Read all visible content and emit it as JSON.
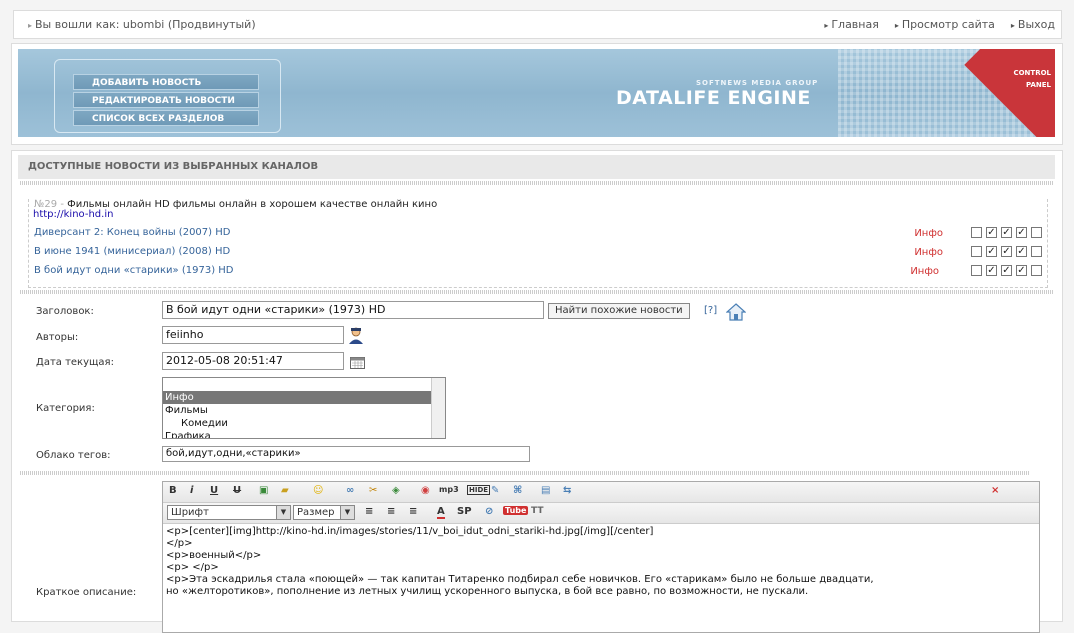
{
  "topbar": {
    "logged_in": "Вы вошли как: ubombi (Продвинутый)",
    "links": [
      "Главная",
      "Просмотр сайта",
      "Выход"
    ]
  },
  "banner": {
    "menu": [
      "ДОБАВИТЬ НОВОСТЬ",
      "РЕДАКТИРОВАТЬ НОВОСТИ",
      "СПИСОК ВСЕХ РАЗДЕЛОВ"
    ],
    "subtitle": "SOFTNEWS MEDIA GROUP",
    "logo": "DATALIFE ENGINE",
    "corner_line1": "CONTROL",
    "corner_line2": "PANEL"
  },
  "section_title": "ДОСТУПНЫЕ НОВОСТИ ИЗ ВЫБРАННЫХ КАНАЛОВ",
  "feed": {
    "number": "№29",
    "sep": "-",
    "title": "Фильмы онлайн HD фильмы онлайн в хорошем качестве онлайн кино",
    "url": "http://kino-hd.in",
    "items": [
      {
        "title": "Диверсант 2: Конец войны (2007) HD",
        "info": "Инфо",
        "checks": [
          false,
          true,
          true,
          true,
          false
        ]
      },
      {
        "title": "В июне 1941 (минисериал) (2008) HD",
        "info": "Инфо",
        "checks": [
          false,
          true,
          true,
          true,
          false
        ]
      },
      {
        "title": "В бой идут одни «старики» (1973) HD",
        "info": "Инфо",
        "checks": [
          false,
          true,
          true,
          true,
          false
        ]
      }
    ]
  },
  "form": {
    "title_label": "Заголовок:",
    "title_value": "В бой идут одни «старики» (1973) HD",
    "find_button": "Найти похожие новости",
    "help": "[?]",
    "authors_label": "Авторы:",
    "authors_value": "feiinho",
    "date_label": "Дата текущая:",
    "date_value": "2012-05-08 20:51:47",
    "category_label": "Категория:",
    "categories": [
      "",
      "Инфо",
      "Фильмы",
      "Комедии",
      "Графика"
    ],
    "selected_category": "Инфо",
    "tags_label": "Облако тегов:",
    "tags_value": "бой,идут,одни,«старики»",
    "short_label": "Краткое описание:"
  },
  "editor": {
    "font_select": "Шрифт",
    "size_select": "Размер",
    "text": "<p>[center][img]http://kino-hd.in/images/stories/11/v_boi_idut_odni_stariki-hd.jpg[/img][/center]\n</p>\n<p>военный</p>\n<p> </p>\n<p>Эта эскадрилья стала «поющей» — так капитан Титаренко подбирал себе новичков. Его «старикам» было не больше двадцати,\nно «желторотиков», пополнение из летных училищ ускоренного выпуска, в бой все равно, по возможности, не пускали."
  },
  "colors": {
    "link": "#36649a",
    "info": "#d03030",
    "banner": "#9dc1d8",
    "accent": "#c9353a"
  }
}
